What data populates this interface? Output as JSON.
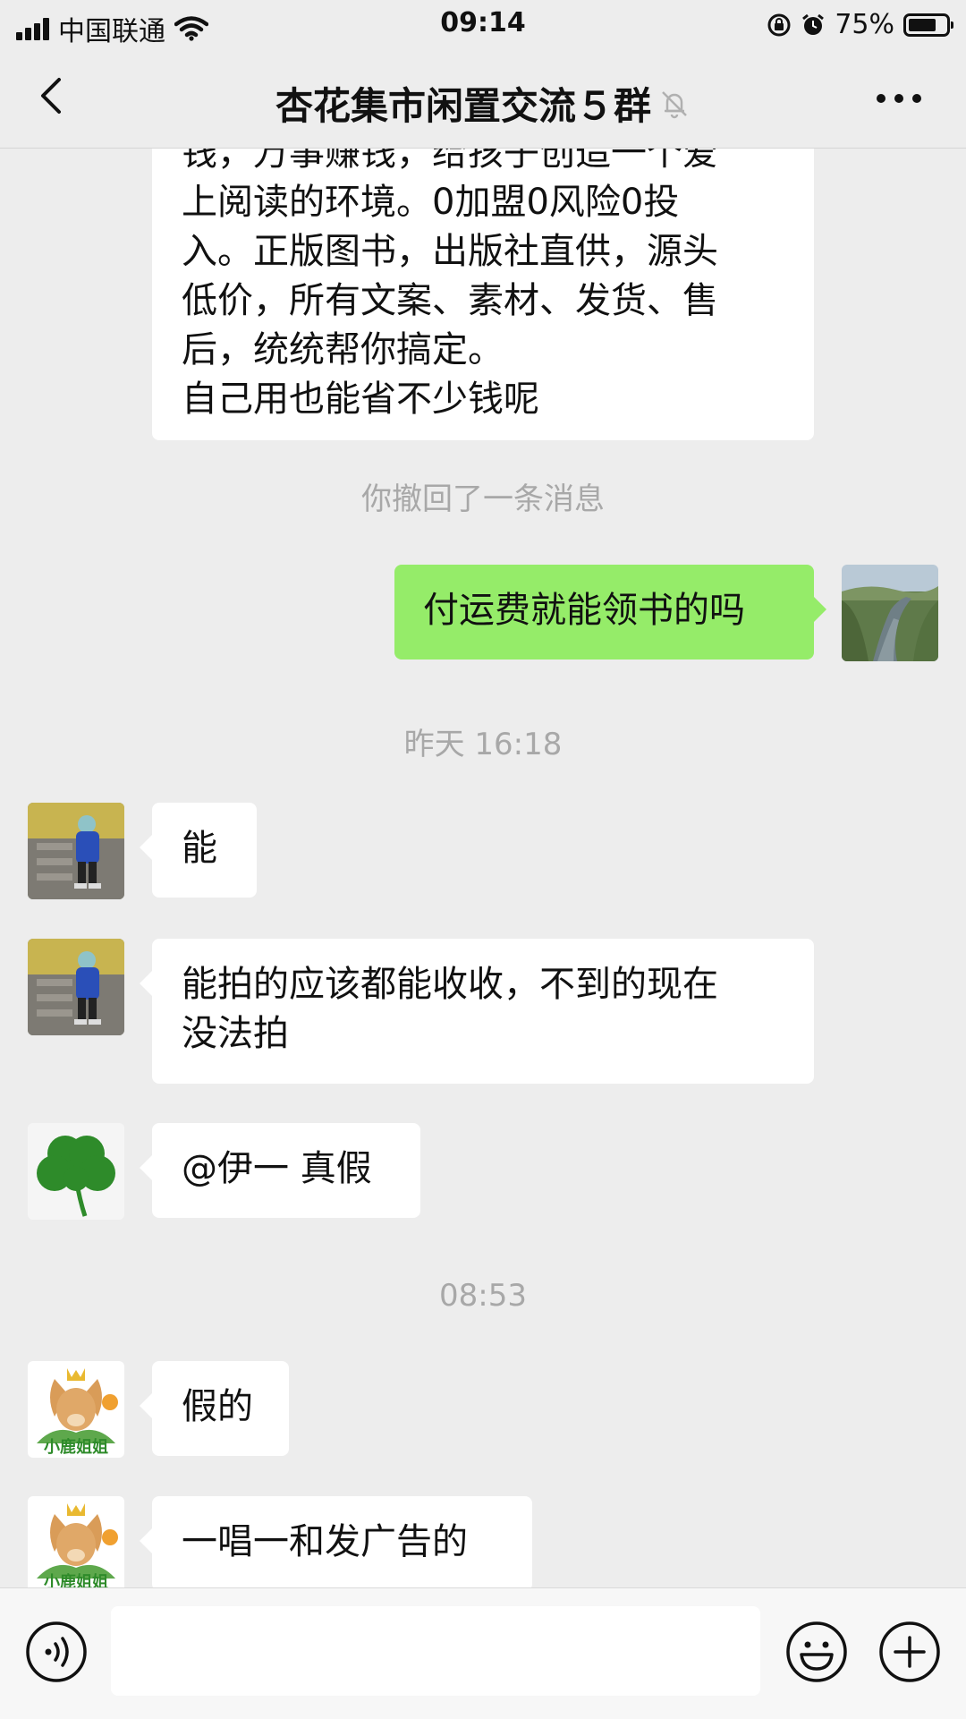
{
  "status_bar": {
    "carrier": "中国联通",
    "time": "09:14",
    "battery_percent": "75%",
    "battery_level": 0.75
  },
  "nav": {
    "title": "杏花集市闲置交流５群",
    "muted": true
  },
  "messages": {
    "m1": {
      "text_partial_top": "钱，万事赚钱，给孩子创造一个爱",
      "lines": [
        "上阅读的环境。0加盟0风险0投",
        "入。正版图书，出版社直供，源头",
        "低价，所有文案、素材、发货、售",
        "后，统统帮你搞定。",
        "自己用也能省不少钱呢"
      ]
    },
    "system_recall": "你撤回了一条消息",
    "m2": {
      "text": "付运费就能领书的吗"
    },
    "time_1": "昨天 16:18",
    "m3": {
      "text": "能"
    },
    "m4": {
      "lines": [
        "能拍的应该都能收收，不到的现在",
        "没法拍"
      ]
    },
    "m5": {
      "text": "@伊一 真假"
    },
    "time_2": "08:53",
    "m6": {
      "text": "假的"
    },
    "m7": {
      "text": "一唱一和发广告的"
    },
    "deer_avatar_label": "小鹿姐姐"
  },
  "colors": {
    "background": "#EDEDED",
    "outgoing_bubble": "#95EC69",
    "incoming_bubble": "#FFFFFF",
    "system_text": "#A8A8A8"
  },
  "icons": {
    "back": "chevron-left-icon",
    "mute": "bell-muted-icon",
    "more": "more-dots-icon",
    "voice": "voice-icon",
    "emoji": "emoji-icon",
    "plus": "plus-icon",
    "wifi": "wifi-icon",
    "alarm": "alarm-icon",
    "rotation_lock": "rotation-lock-icon"
  }
}
